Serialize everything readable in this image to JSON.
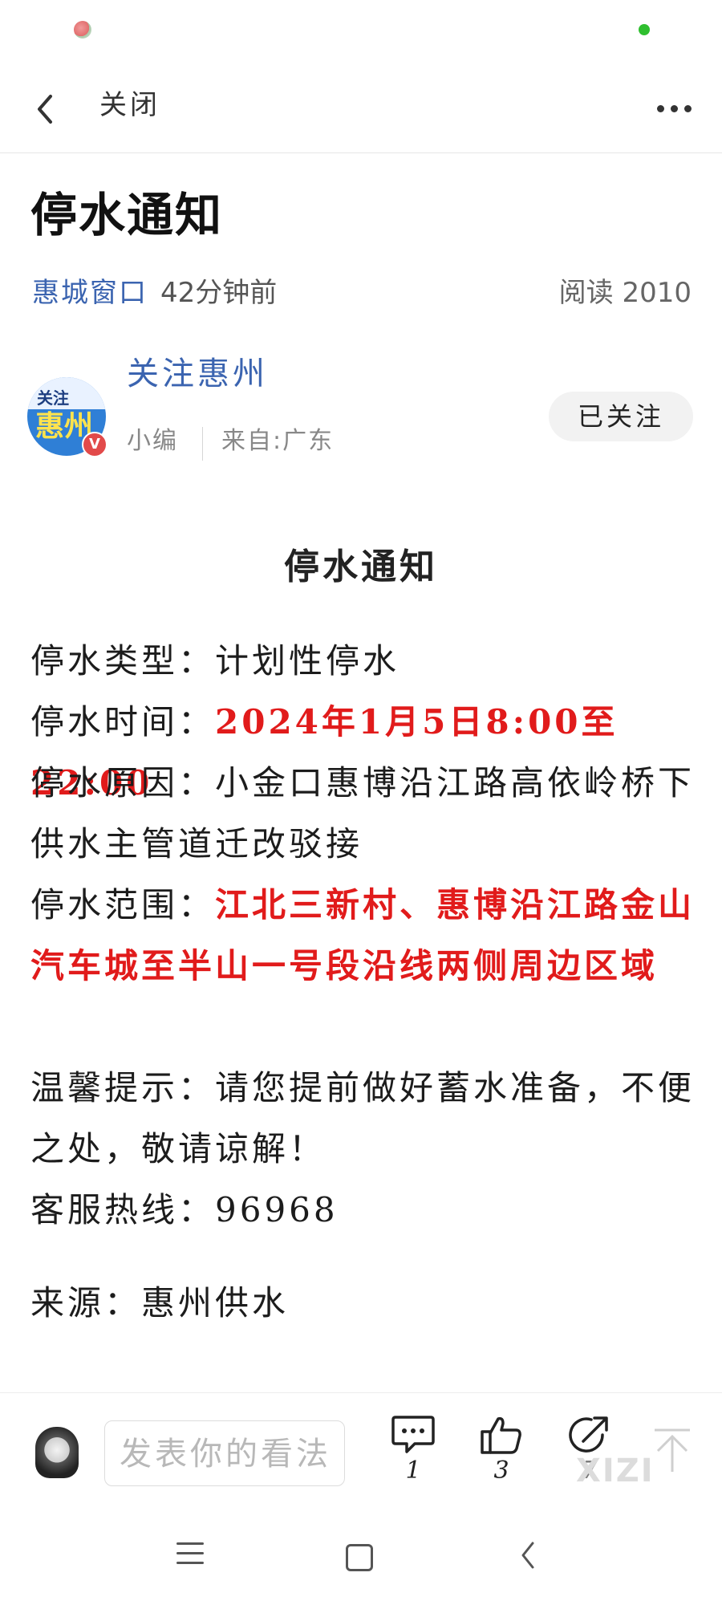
{
  "nav": {
    "close_label": "关闭"
  },
  "article": {
    "title": "停水通知",
    "source": "惠城窗口",
    "time": "42分钟前",
    "reads": "阅读 2010"
  },
  "author": {
    "avatar_text_top": "关注",
    "avatar_text_bottom": "惠州",
    "verified_badge": "V",
    "name": "关注惠州",
    "role": "小编",
    "location": "来自:广东",
    "follow_label": "已关注"
  },
  "body": {
    "heading": "停水通知",
    "type_label": "停水类型：",
    "type_value": "计划性停水",
    "time_label": "停水时间：",
    "time_value": "2024年1月5日8:00至22:00",
    "reason_label": "停水原因：",
    "reason_value": "小金口惠博沿江路高依岭桥下供水主管道迁改驳接",
    "range_label": "停水范围：",
    "range_value": "江北三新村、惠博沿江路金山汽车城至半山一号段沿线两侧周边区域",
    "tip_label": "温馨提示：",
    "tip_value": "请您提前做好蓄水准备，不便之处，敬请谅解！",
    "hotline_label": "客服热线：",
    "hotline_value": "96968",
    "origin_label": "来源：",
    "origin_value": "惠州供水"
  },
  "bottom_bar": {
    "comment_placeholder": "发表你的看法",
    "comment_count": "1",
    "like_count": "3",
    "share_count": "7",
    "watermark": "XIZI"
  },
  "colors": {
    "link_blue": "#3b64b0",
    "highlight_red": "#e11b1b"
  }
}
